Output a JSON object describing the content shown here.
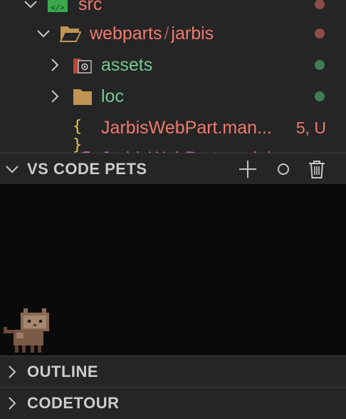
{
  "explorer": {
    "rows": [
      {
        "name": "src",
        "status": ""
      },
      {
        "name_parts": [
          "webparts",
          "/",
          "jarbis"
        ]
      },
      {
        "name": "assets"
      },
      {
        "name": "loc"
      },
      {
        "name": "JarbisWebPart.man...",
        "status": "5, U",
        "icon_glyph": "{ }"
      },
      {
        "name": "JarbisWebPart.module..."
      }
    ]
  },
  "pets_panel": {
    "title": "VS CODE PETS",
    "actions": [
      "add-pet",
      "throw-ball",
      "delete-pet"
    ],
    "pet": "brown-cat"
  },
  "sections": {
    "outline": "OUTLINE",
    "codetour": "CODETOUR"
  },
  "colors": {
    "modified_red": "#f07a6c",
    "untracked_green": "#73c991",
    "sidebar_bg": "#252526",
    "pets_bg": "#0a0a0a"
  }
}
